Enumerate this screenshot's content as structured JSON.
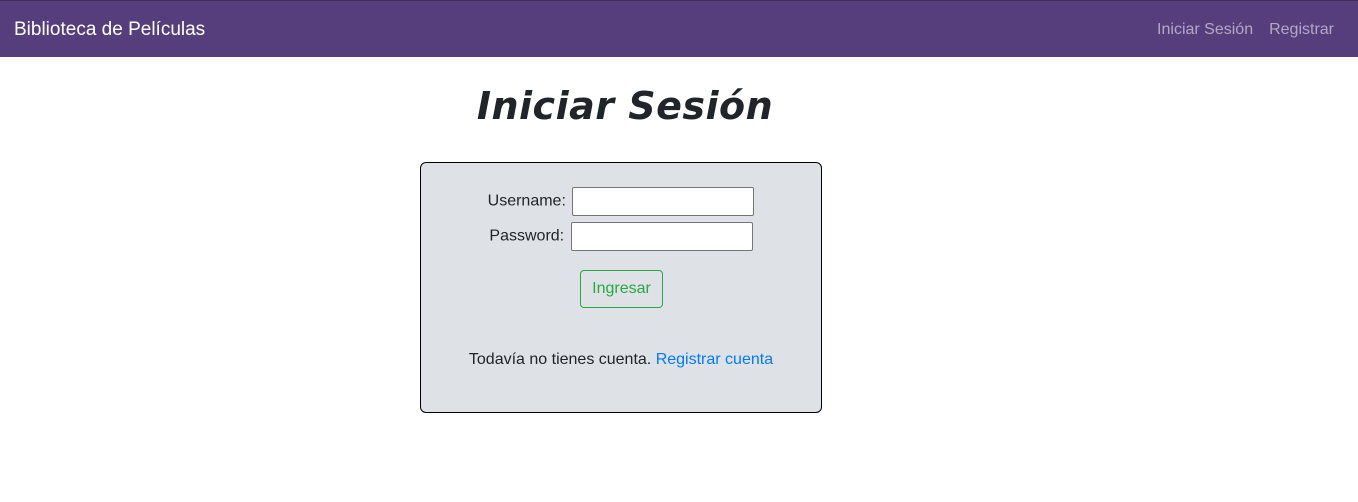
{
  "navbar": {
    "brand": "Biblioteca de Películas",
    "links": [
      {
        "label": "Iniciar Sesión"
      },
      {
        "label": "Registrar"
      }
    ],
    "background_color": "#563d7c"
  },
  "main": {
    "title": "Iniciar Sesión"
  },
  "login_form": {
    "username_label": "Username:",
    "username_value": "",
    "password_label": "Password:",
    "password_value": "",
    "submit_label": "Ingresar",
    "no_account_text": "Todavía no tienes cuenta.",
    "register_link_label": "Registrar cuenta",
    "card_background": "#dee2e6",
    "submit_color": "#28a745",
    "link_color": "#007bff"
  }
}
